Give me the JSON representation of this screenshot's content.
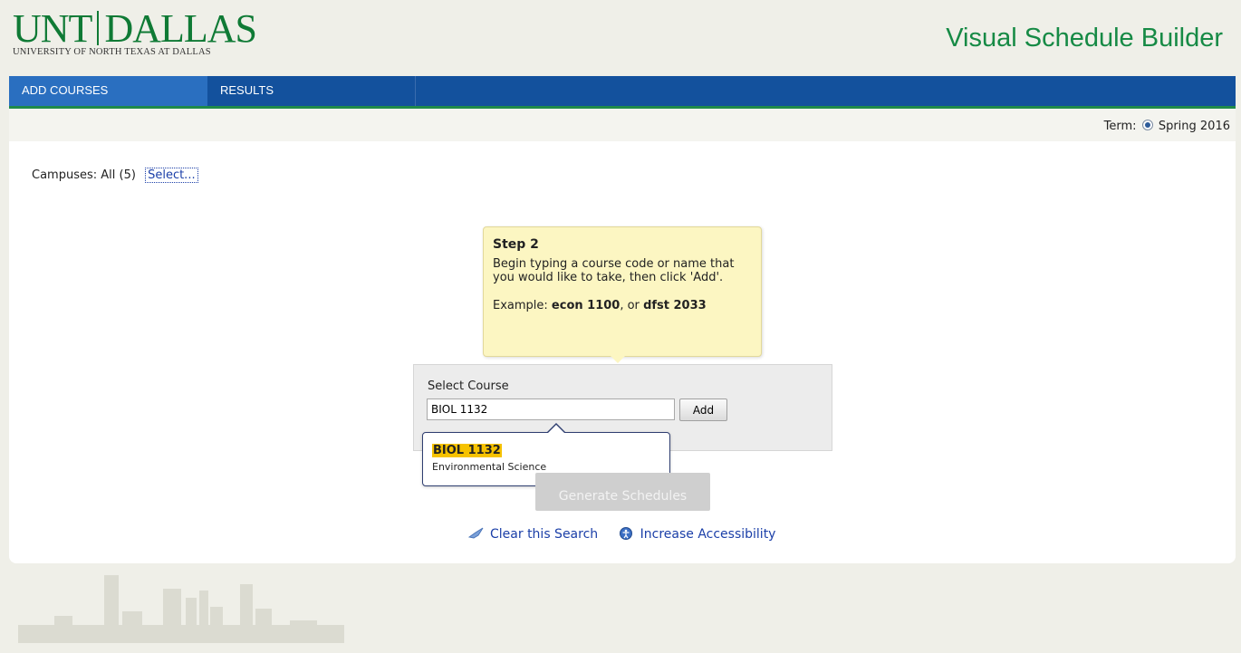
{
  "header": {
    "logo_main": "UNT DALLAS",
    "logo_left": "UNT",
    "logo_right": "DALLAS",
    "logo_sub": "UNIVERSITY OF NORTH TEXAS AT DALLAS",
    "app_title": "Visual Schedule Builder"
  },
  "nav": {
    "tabs": [
      {
        "label": "ADD COURSES",
        "active": true
      },
      {
        "label": "RESULTS",
        "active": false
      }
    ]
  },
  "term": {
    "label": "Term:",
    "value": "Spring 2016"
  },
  "campuses": {
    "label": "Campuses:",
    "value": "All (5)",
    "select_link": "Select..."
  },
  "tooltip": {
    "title": "Step 2",
    "body": "Begin typing a course code or name that you would like to take, then click 'Add'.",
    "example_prefix": "Example:",
    "example_1": "econ 1100",
    "example_or": ", or",
    "example_2": "dfst 2033"
  },
  "select_course": {
    "label": "Select Course",
    "input_value": "BIOL 1132",
    "add_label": "Add"
  },
  "suggestion": {
    "code": "BIOL 1132",
    "name": "Environmental Science"
  },
  "generate_label": "Generate Schedules",
  "links": {
    "clear": "Clear this Search",
    "accessibility": "Increase Accessibility"
  },
  "colors": {
    "brand_green": "#0f7a35",
    "nav_blue": "#13519d",
    "tab_active": "#2a6fc0",
    "tooltip_bg": "#fcf6c2",
    "highlight": "#f6c200"
  }
}
